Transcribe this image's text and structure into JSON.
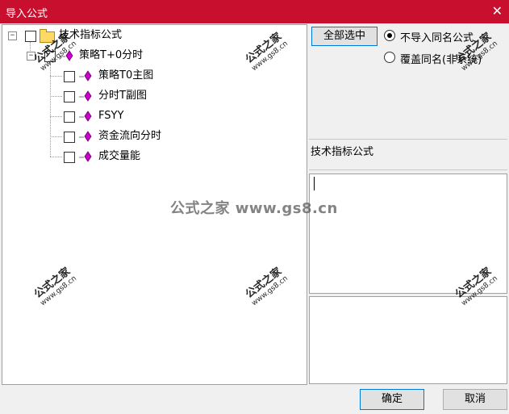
{
  "window": {
    "title": "导入公式",
    "close_glyph": "✕"
  },
  "tree": {
    "root": {
      "expander": "−",
      "label": "技术指标公式"
    },
    "group": {
      "expander": "−",
      "label": "策略T+0分时"
    },
    "items": [
      {
        "label": "策略T0主图"
      },
      {
        "label": "分时T副图"
      },
      {
        "label": "FSYY"
      },
      {
        "label": "资金流向分时"
      },
      {
        "label": "成交量能"
      }
    ]
  },
  "right": {
    "select_all_button": "全部选中",
    "option_skip": "不导入同名公式",
    "option_overwrite": "覆盖同名(非系统)",
    "category_label": "技术指标公式"
  },
  "footer": {
    "ok": "确定",
    "cancel": "取消"
  },
  "watermark": {
    "text": "公式之家 www.gs8.cn",
    "stamp_main": "公式之家",
    "stamp_url": "www.gs8.cn"
  },
  "colors": {
    "titlebar": "#c8102e",
    "leaf_icon": "#cc00cc",
    "folder": "#ffd966"
  }
}
